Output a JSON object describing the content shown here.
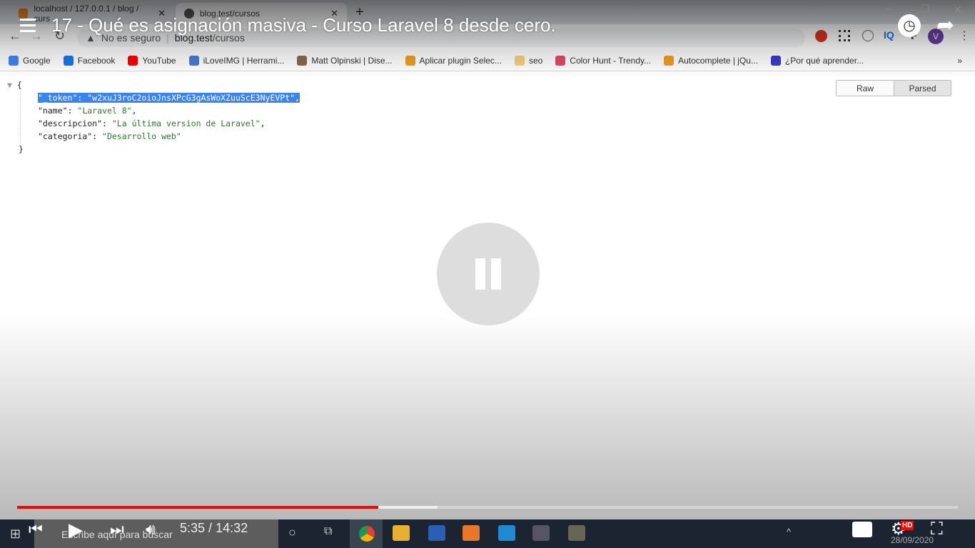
{
  "browser": {
    "tabs": [
      {
        "label": "localhost / 127.0.0.1 / blog / curs"
      },
      {
        "label": "blog.test/cursos"
      }
    ],
    "security": "No es seguro",
    "url_host": "blog.test",
    "url_path": "/cursos",
    "bookmarks": [
      {
        "label": "Google",
        "color": "#4285f4"
      },
      {
        "label": "Facebook",
        "color": "#1877f2"
      },
      {
        "label": "YouTube",
        "color": "#ff0000"
      },
      {
        "label": "iLoveIMG | Herrami...",
        "color": "#4a7bd8"
      },
      {
        "label": "Matt Olpinski | Dise...",
        "color": "#8a6a50"
      },
      {
        "label": "Aplicar plugin Selec...",
        "color": "#f0a020"
      },
      {
        "label": "seo",
        "color": "#f2d27a"
      },
      {
        "label": "Color Hunt - Trendy...",
        "color": "#e04a6a"
      },
      {
        "label": "Autocomplete | jQu...",
        "color": "#f0a020"
      },
      {
        "label": "¿Por qué aprender...",
        "color": "#3b3bcf"
      }
    ],
    "more": "»"
  },
  "json_viewer": {
    "open": "{",
    "close": "}",
    "rows": [
      {
        "key": "\"_token\"",
        "value": "\"w2xuJ3roC2oioJnsXPcG3gAsWoXZuuScE3NyEVPt\"",
        "comma": ","
      },
      {
        "key": "\"name\"",
        "value": "\"Laravel 8\"",
        "comma": ","
      },
      {
        "key": "\"descripcion\"",
        "value": "\"La última version de Laravel\"",
        "comma": ","
      },
      {
        "key": "\"categoria\"",
        "value": "\"Desarrollo web\"",
        "comma": ""
      }
    ],
    "raw": "Raw",
    "parsed": "Parsed"
  },
  "video": {
    "title": "17 - Qué es asignación masiva - Curso Laravel 8 desde cero.",
    "current": "5:35",
    "sep": " / ",
    "duration": "14:32",
    "played_fraction": 0.384,
    "buffered_fraction": 0.447,
    "hd": "HD"
  },
  "taskbar": {
    "search_placeholder": "Escribe aquí para buscar",
    "date": "28/09/2020"
  }
}
